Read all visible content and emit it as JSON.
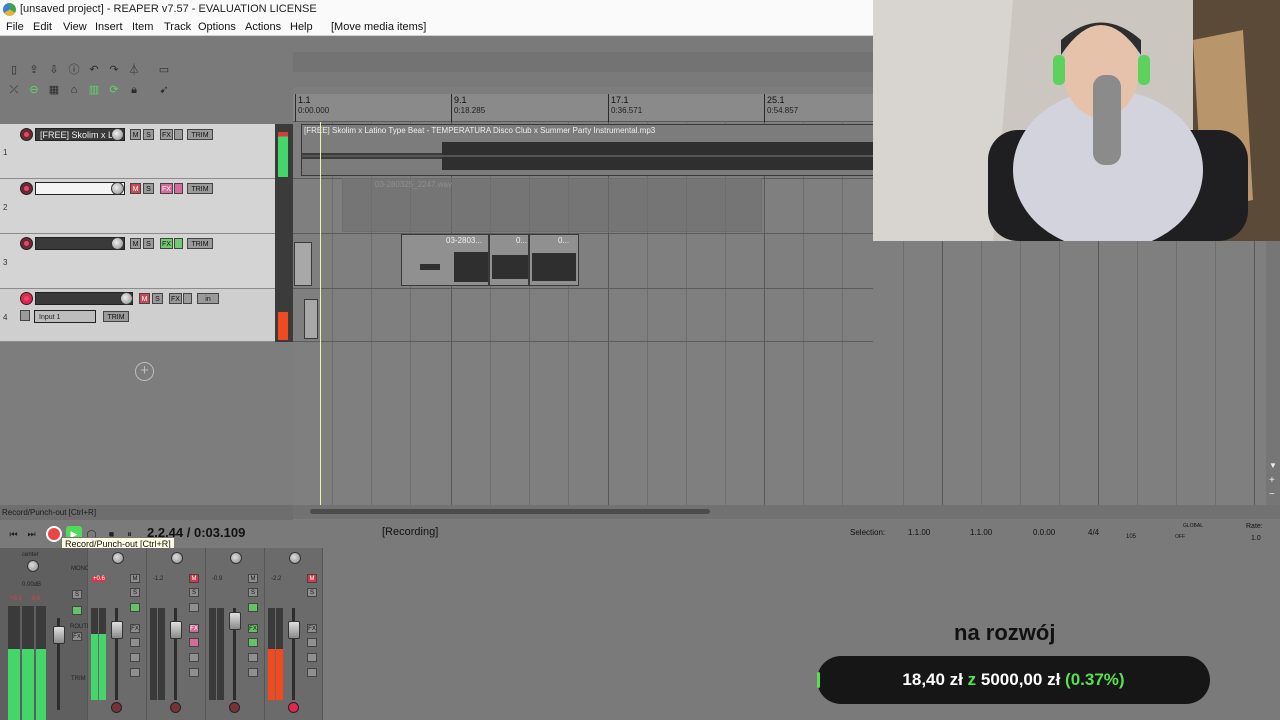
{
  "window": {
    "title": "[unsaved project] - REAPER v7.57 - EVALUATION LICENSE"
  },
  "menu": {
    "items": [
      "File",
      "Edit",
      "View",
      "Insert",
      "Item",
      "Track",
      "Options",
      "Actions",
      "Help"
    ],
    "action_hint": "[Move media items]"
  },
  "ruler": {
    "markers": [
      {
        "bar": "1.1",
        "time": "0:00.000"
      },
      {
        "bar": "9.1",
        "time": "0:18.285"
      },
      {
        "bar": "17.1",
        "time": "0:36.571"
      },
      {
        "bar": "25.1",
        "time": "0:54.857"
      }
    ]
  },
  "tracks": [
    {
      "number": "1",
      "name": "[FREE] Skolim x La"
    },
    {
      "number": "2",
      "name": ""
    },
    {
      "number": "3",
      "name": ""
    },
    {
      "number": "4",
      "name": "",
      "input": "Input 1",
      "io": "in"
    }
  ],
  "track_buttons": {
    "mute": "M",
    "solo": "S",
    "fx": "FX",
    "trim": "TRIM"
  },
  "items": {
    "beat": "[FREE] Skolim x Latino Type Beat - TEMPERATURA  Disco Club x Summer Party Instrumental.mp3",
    "take_a": "03-2803...",
    "take_b": "0...",
    "take_c": "0...",
    "ghost": "03-280325_2247.wav"
  },
  "status": {
    "left_hint": "Record/Punch-out [Ctrl+R]",
    "tooltip": "Record/Punch-out [Ctrl+R]",
    "time": "2.2.44 / 0:03.109",
    "recording": "[Recording]",
    "selection_label": "Selection:",
    "selection_start": "1.1.00",
    "selection_end": "1.1.00",
    "selection_length": "0.0.00",
    "time_signature": "4/4",
    "bpm": "105",
    "rate_label": "Rate:",
    "rate_value": "1.0",
    "global_label": "GLOBAL",
    "global_state": "OFF"
  },
  "mixer": {
    "master": {
      "pan": "center",
      "volume": "0.00dB",
      "peak_l": "+6.6",
      "peak_r": "-6.6",
      "labels": [
        "MONO",
        "ROUTE",
        "TRIM"
      ],
      "meter_level": 0.62
    },
    "channels": [
      {
        "peak": "+0.6",
        "meter_level": 0.72,
        "fader_level": 0.82,
        "rec_active": false
      },
      {
        "peak": "-1.2",
        "meter_level": 0.0,
        "fader_level": 0.82,
        "rec_active": false
      },
      {
        "peak": "-0.9",
        "meter_level": 0.0,
        "fader_level": 0.95,
        "rec_active": false
      },
      {
        "peak": "-2.2",
        "meter_level": 0.55,
        "fader_level": 0.82,
        "rec_active": true
      }
    ]
  },
  "overlay": {
    "title": "na rozwój",
    "amount": "18,40 zł",
    "connector": "z",
    "target": "5000,00 zł",
    "percent": "(0.37%)",
    "progress": 0.0037
  },
  "colors": {
    "record": "#e2264d",
    "meter": "#44d66b",
    "meter_hot": "#f04a1e",
    "accent_green": "#57e04f"
  }
}
